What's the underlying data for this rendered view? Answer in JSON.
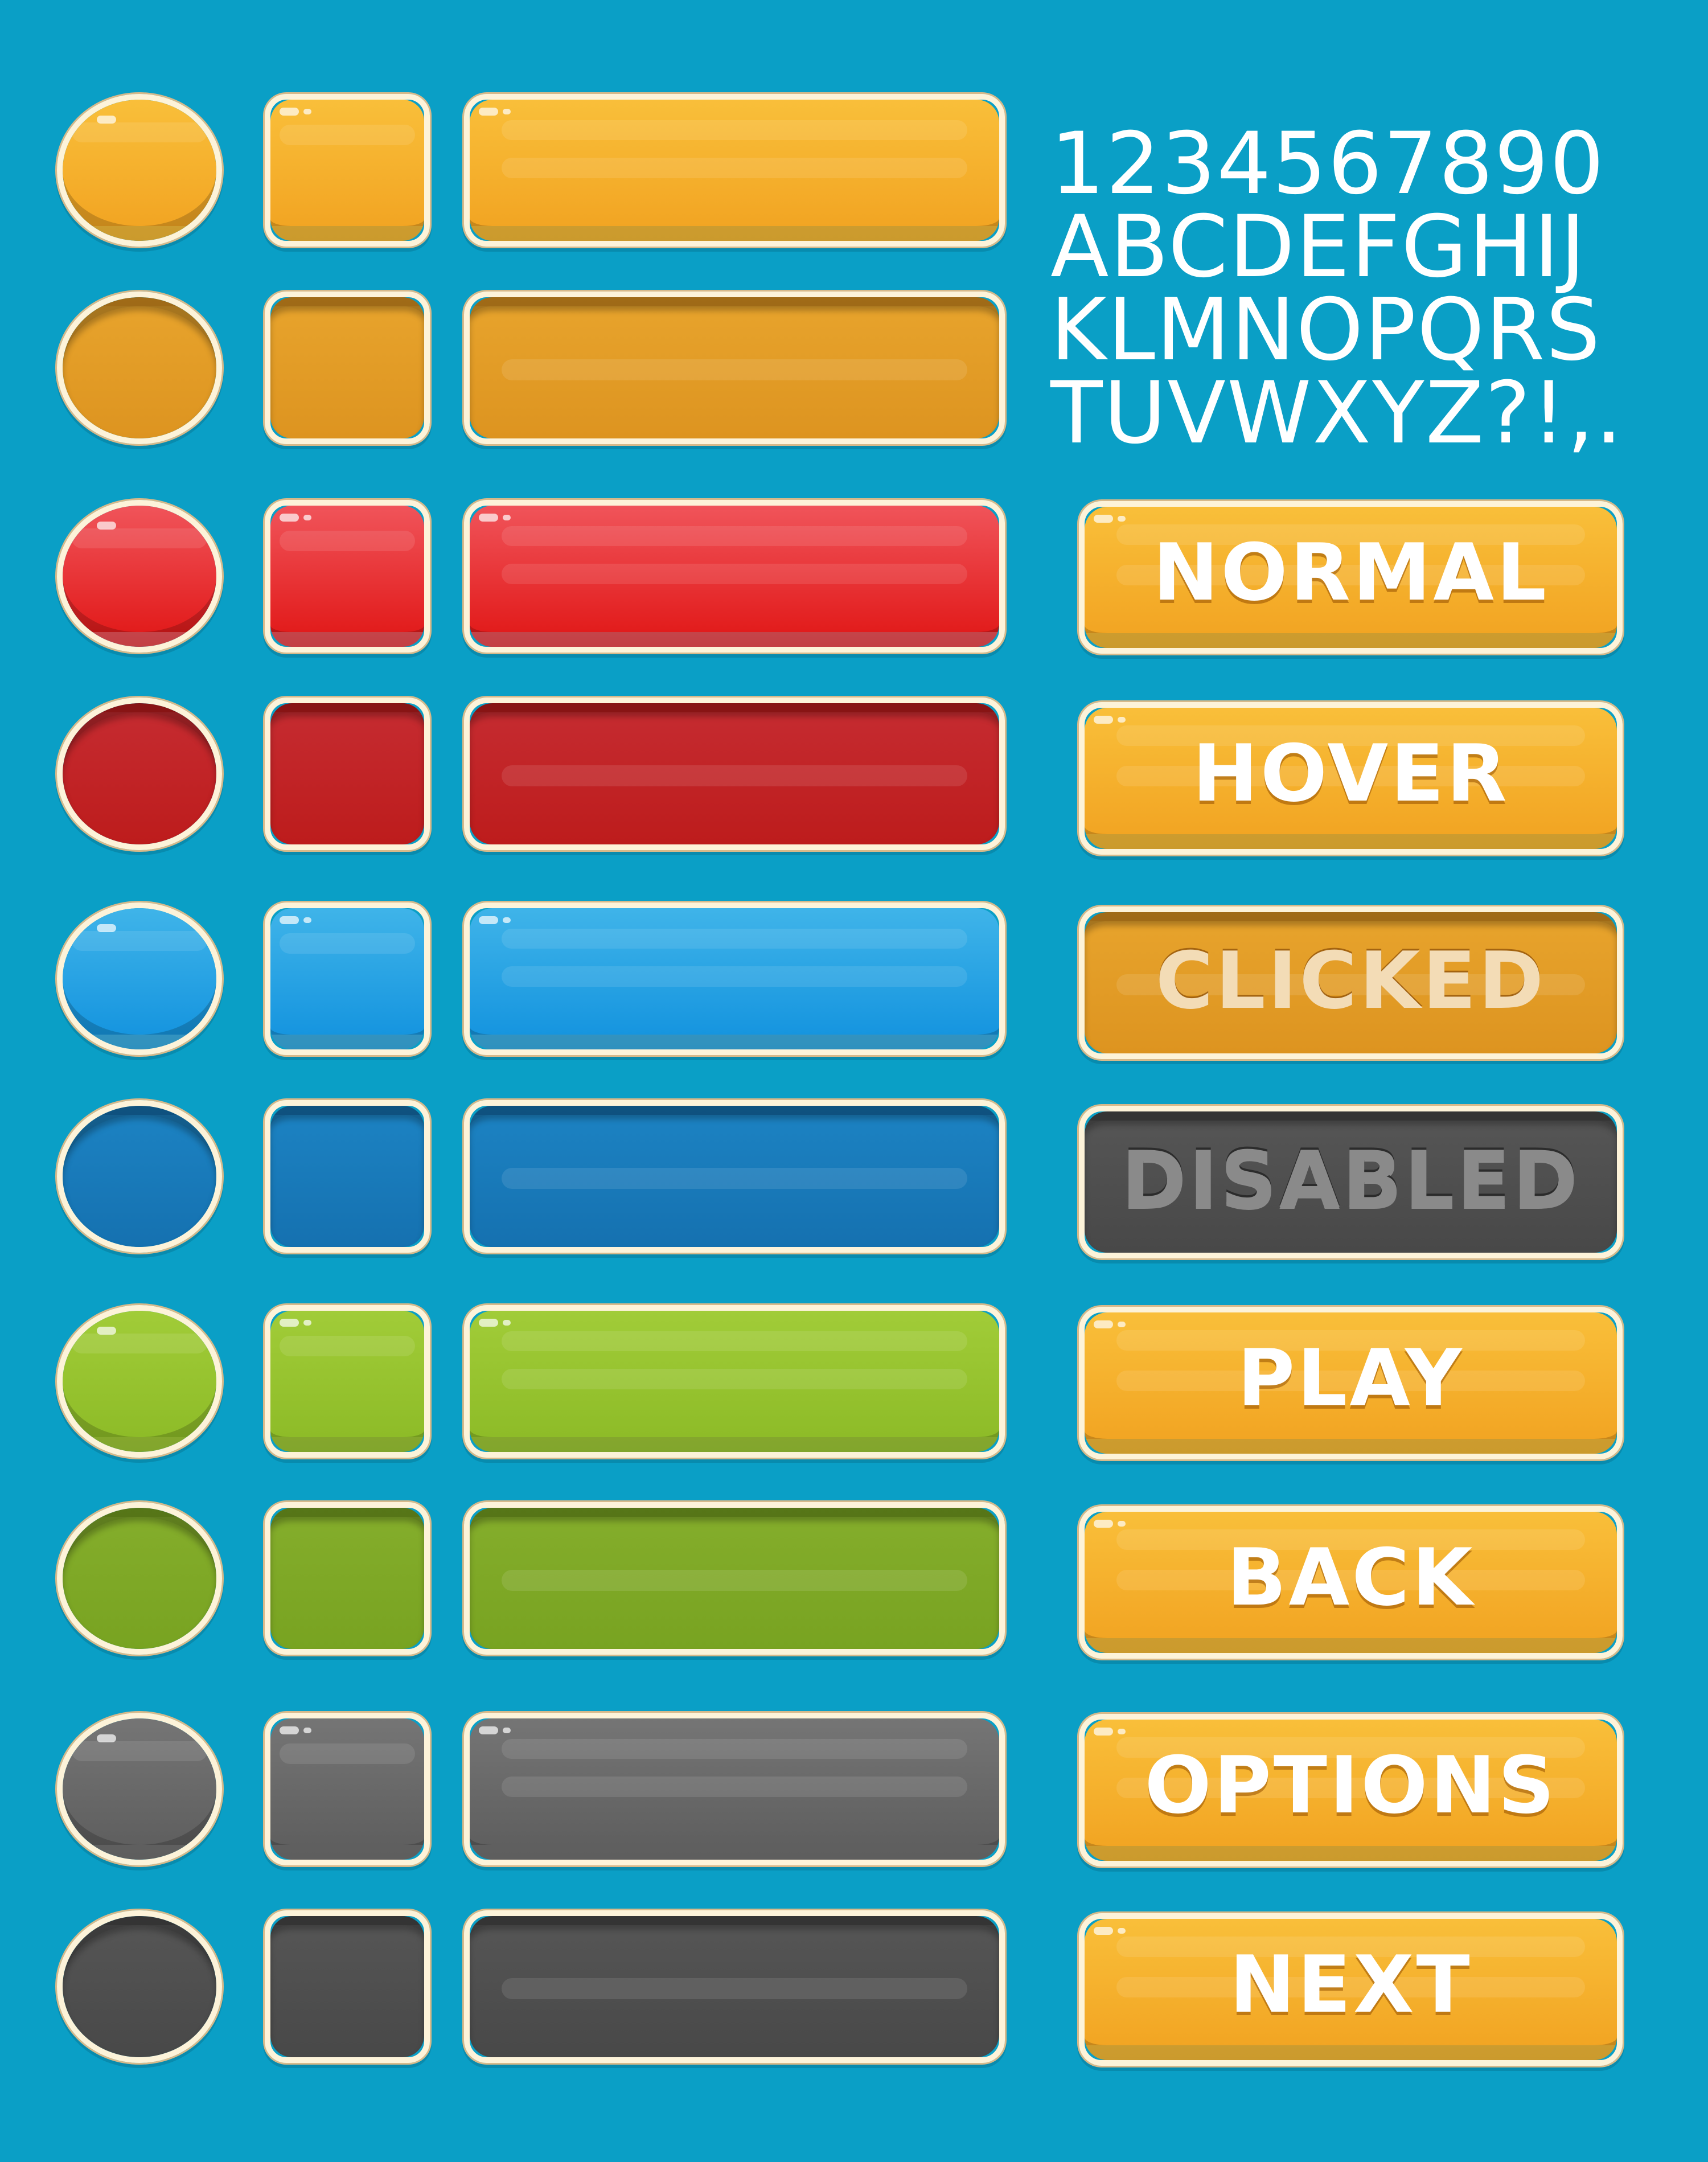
{
  "background_color": "#0a9fc6",
  "font_sample": {
    "digits": "1234567890",
    "letters_1": "ABCDEFGHIJ",
    "letters_2": "KLMNOPQRS",
    "letters_3": "TUVWXYZ?!,."
  },
  "button_rows": [
    {
      "color": "orange",
      "state": "normal"
    },
    {
      "color": "orange",
      "state": "pressed"
    },
    {
      "color": "red",
      "state": "normal"
    },
    {
      "color": "red",
      "state": "pressed"
    },
    {
      "color": "blue",
      "state": "normal"
    },
    {
      "color": "blue",
      "state": "pressed"
    },
    {
      "color": "green",
      "state": "normal"
    },
    {
      "color": "green",
      "state": "pressed"
    },
    {
      "color": "gray",
      "state": "normal"
    },
    {
      "color": "gray",
      "state": "pressed"
    }
  ],
  "text_buttons": {
    "normal": "NORMAL",
    "hover": "HOVER",
    "clicked": "CLICKED",
    "disabled": "DISABLED",
    "play": "PLAY",
    "back": "BACK",
    "options": "OPTIONS",
    "next": "NEXT"
  },
  "colors": {
    "orange": "#f9bf3a",
    "red": "#e21c1c",
    "blue": "#1695df",
    "green": "#8ebc28",
    "gray": "#5f5f5f",
    "button_border": "#fdf3d9"
  }
}
